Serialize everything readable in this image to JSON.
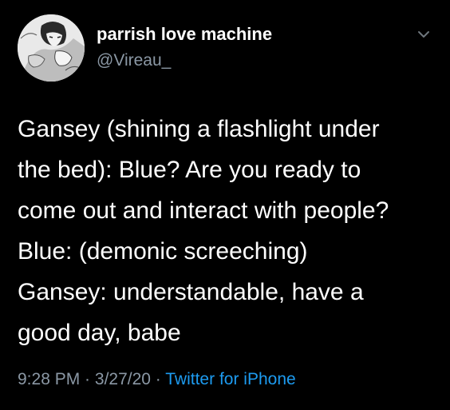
{
  "user": {
    "display_name": "parrish love machine",
    "handle": "@Vireau_",
    "avatar_icon": "manga-avatar"
  },
  "menu_icon": "chevron-down-icon",
  "tweet": {
    "lines": [
      "Gansey (shining a flashlight under",
      "the bed): Blue? Are you ready to",
      "come out and interact with people?",
      "Blue: (demonic screeching)",
      "Gansey: understandable, have a",
      "good day, babe"
    ]
  },
  "meta": {
    "time": "9:28 PM",
    "sep1": " · ",
    "date": "3/27/20",
    "sep2": " · ",
    "source": "Twitter for iPhone"
  },
  "colors": {
    "background": "#000000",
    "text": "#ffffff",
    "secondary": "#8b98a5",
    "link": "#1d9bf0"
  }
}
